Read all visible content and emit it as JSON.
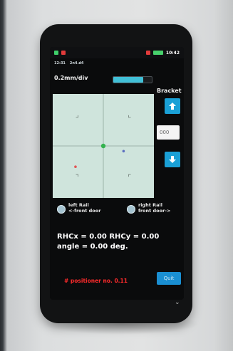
{
  "status": {
    "time": "10:42"
  },
  "info": {
    "line1": "12:31",
    "line2": "2n4.d4"
  },
  "scale": {
    "label": "0.2mm/div",
    "level": 0.78
  },
  "bracket": {
    "label": "Bracket",
    "value": "000",
    "up_icon": "arrow-up-icon",
    "down_icon": "arrow-down-icon"
  },
  "plot_points": [
    {
      "name": "center-point",
      "x": 0,
      "y": 0,
      "color": "#34b24f"
    },
    {
      "name": "blue-point",
      "x": 0.4,
      "y": -0.1,
      "color": "#5c6fbf"
    },
    {
      "name": "red-point",
      "x": -0.55,
      "y": -0.4,
      "color": "#e25555"
    }
  ],
  "options": [
    {
      "id": "left",
      "line1": "left Rail",
      "line2": "<-front door"
    },
    {
      "id": "right",
      "line1": "right Rail",
      "line2": "front door->"
    }
  ],
  "results": {
    "line1": "RHCx = 0.00 RHCy = 0.00",
    "line2": "angle = 0.00 deg."
  },
  "positioner": {
    "text": "# positioner no. 0.11"
  },
  "quit_label": "Quit",
  "colors": {
    "accent": "#1aa0d6",
    "warning": "#ff2b2b",
    "plot_bg": "#cfe4dc"
  }
}
